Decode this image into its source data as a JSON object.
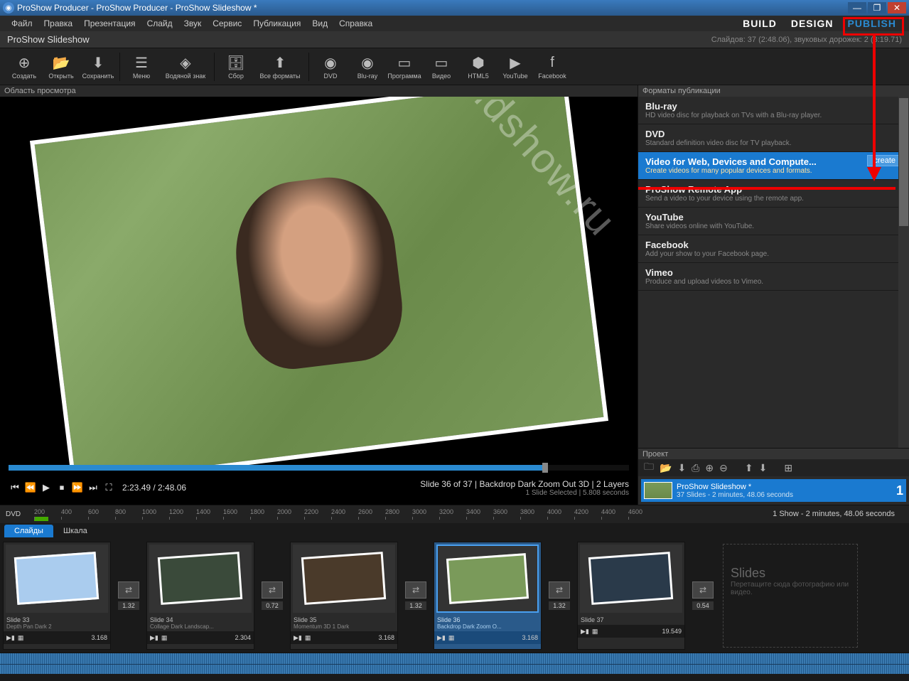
{
  "window": {
    "title": "ProShow Producer - ProShow Producer - ProShow Slideshow *"
  },
  "menu": [
    "Файл",
    "Правка",
    "Презентация",
    "Слайд",
    "Звук",
    "Сервис",
    "Публикация",
    "Вид",
    "Справка"
  ],
  "modes": {
    "build": "BUILD",
    "design": "DESIGN",
    "publish": "PUBLISH"
  },
  "showbar": {
    "title": "ProShow Slideshow",
    "stats": "Слайдов: 37 (2:48.06), звуковых дорожек: 2 (3:19.71)"
  },
  "toolbar": [
    {
      "label": "Создать",
      "icon": "new"
    },
    {
      "label": "Открыть",
      "icon": "open"
    },
    {
      "label": "Сохранить",
      "icon": "save"
    },
    {
      "sep": true
    },
    {
      "label": "Меню",
      "icon": "menu"
    },
    {
      "label": "Водяной знак",
      "icon": "watermark"
    },
    {
      "sep": true
    },
    {
      "label": "Сбор",
      "icon": "collect"
    },
    {
      "label": "Все форматы",
      "icon": "allformats"
    },
    {
      "sep": true
    },
    {
      "label": "DVD",
      "icon": "disc"
    },
    {
      "label": "Blu-ray",
      "icon": "disc"
    },
    {
      "label": "Программа",
      "icon": "exe"
    },
    {
      "label": "Видео",
      "icon": "video"
    },
    {
      "label": "HTML5",
      "icon": "html5"
    },
    {
      "label": "YouTube",
      "icon": "youtube"
    },
    {
      "label": "Facebook",
      "icon": "facebook"
    }
  ],
  "preview": {
    "label": "Область просмотра",
    "watermark": "slidshow.ru"
  },
  "player": {
    "time": "2:23.49 / 2:48.06",
    "info": "Slide 36 of 37  |  Backdrop Dark Zoom Out 3D  |  2 Layers",
    "sub": "1 Slide Selected  |  5.808 seconds"
  },
  "publish": {
    "header": "Форматы публикации",
    "create": "create",
    "items": [
      {
        "t": "Blu-ray",
        "d": "HD video disc for playback on TVs with a Blu-ray player."
      },
      {
        "t": "DVD",
        "d": "Standard definition video disc for TV playback."
      },
      {
        "t": "Video for Web, Devices and Compute...",
        "d": "Create videos for many popular devices and formats.",
        "sel": true
      },
      {
        "t": "ProShow Remote App",
        "d": "Send a video to your device using the remote app."
      },
      {
        "t": "YouTube",
        "d": "Share videos online with YouTube."
      },
      {
        "t": "Facebook",
        "d": "Add your show to your Facebook page."
      },
      {
        "t": "Vimeo",
        "d": "Produce and upload videos to Vimeo."
      }
    ]
  },
  "project": {
    "header": "Проект",
    "item": {
      "title": "ProShow Slideshow *",
      "sub": "37 Slides - 2 minutes, 48.06 seconds",
      "num": "1"
    }
  },
  "ruler": {
    "quality": "DVD",
    "ticks": [
      "200",
      "400",
      "600",
      "800",
      "1000",
      "1200",
      "1400",
      "1600",
      "1800",
      "2000",
      "2200",
      "2400",
      "2600",
      "2800",
      "3000",
      "3200",
      "3400",
      "3600",
      "3800",
      "4000",
      "4200",
      "4400",
      "4600"
    ],
    "summary": "1 Show - 2 minutes, 48.06 seconds"
  },
  "tabs": {
    "slides": "Слайды",
    "scale": "Шкала"
  },
  "slides": [
    {
      "n": "33",
      "t": "Slide 33",
      "s": "Depth Pan Dark 2",
      "dur": "3.168",
      "trans": "1.32",
      "bg": "#aaccee"
    },
    {
      "n": "34",
      "t": "Slide 34",
      "s": "Collage Dark Landscap...",
      "dur": "2.304",
      "trans": "0.72",
      "bg": "#3a4a3a"
    },
    {
      "n": "35",
      "t": "Slide 35",
      "s": "Momentum 3D 1 Dark",
      "dur": "3.168",
      "trans": "1.32",
      "bg": "#4a3a2a"
    },
    {
      "n": "36",
      "t": "Slide 36",
      "s": "Backdrop Dark Zoom O...",
      "dur": "3.168",
      "trans": "1.32",
      "bg": "#7a9a5a",
      "sel": true
    },
    {
      "n": "37",
      "t": "Slide 37",
      "s": "",
      "dur": "19.549",
      "trans": "0.54",
      "bg": "#2a3a4a"
    }
  ],
  "dropzone": {
    "t": "Slides",
    "d": "Перетащите сюда фотографию или видео."
  }
}
